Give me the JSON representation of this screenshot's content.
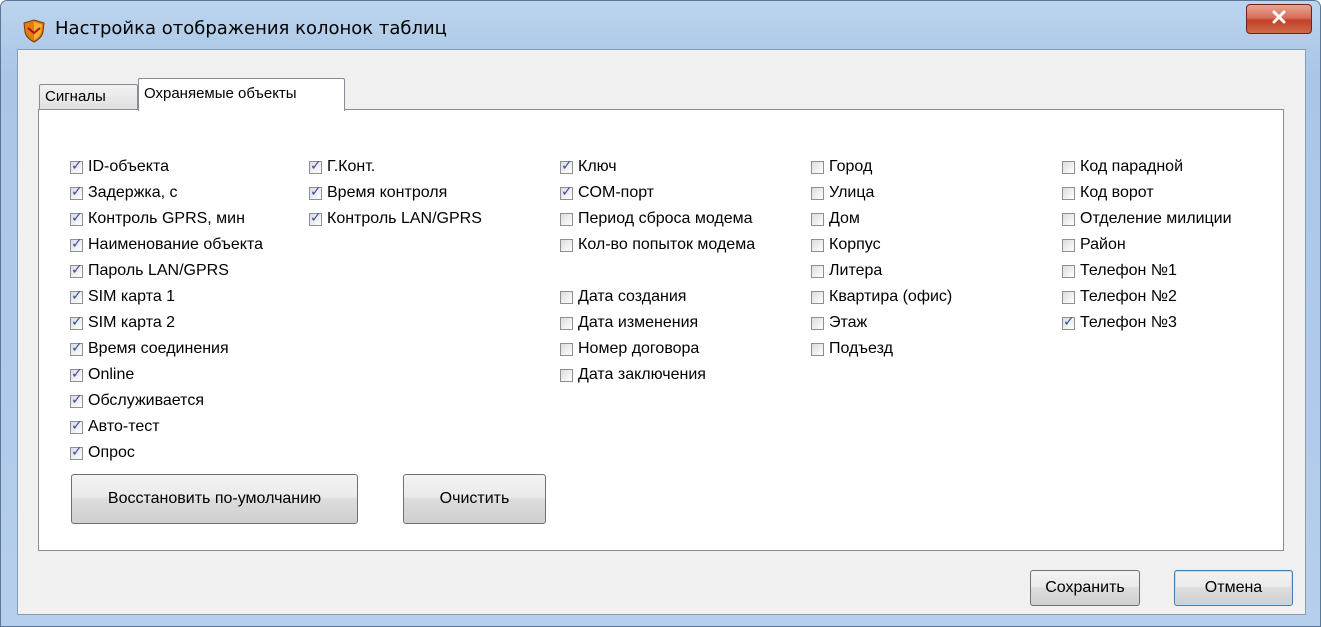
{
  "window": {
    "title": "Настройка отображения колонок таблиц",
    "icon": "shield-icon",
    "close_icon": "close-icon"
  },
  "tabs": [
    {
      "label": "Сигналы",
      "active": false
    },
    {
      "label": "Охраняемые объекты",
      "active": true
    }
  ],
  "columns": [
    {
      "items": [
        {
          "label": "ID-объекта",
          "checked": true
        },
        {
          "label": "Задержка, с",
          "checked": true
        },
        {
          "label": "Контроль GPRS, мин",
          "checked": true
        },
        {
          "label": "Наименование объекта",
          "checked": true
        },
        {
          "label": "Пароль LAN/GPRS",
          "checked": true
        },
        {
          "label": "SIM карта 1",
          "checked": true
        },
        {
          "label": "SIM карта 2",
          "checked": true
        },
        {
          "label": "Время соединения",
          "checked": true
        },
        {
          "label": "Online",
          "checked": true
        },
        {
          "label": "Обслуживается",
          "checked": true
        },
        {
          "label": "Авто-тест",
          "checked": true
        },
        {
          "label": "Опрос",
          "checked": true
        }
      ]
    },
    {
      "items": [
        {
          "label": "Г.Конт.",
          "checked": true
        },
        {
          "label": "Время контроля",
          "checked": true
        },
        {
          "label": "Контроль LAN/GPRS",
          "checked": true
        }
      ]
    },
    {
      "items": [
        {
          "label": "Ключ",
          "checked": true
        },
        {
          "label": "COM-порт",
          "checked": true
        },
        {
          "label": "Период сброса модема",
          "checked": false
        },
        {
          "label": "Кол-во попыток модема",
          "checked": false
        },
        {
          "gap": true
        },
        {
          "label": "Дата создания",
          "checked": false
        },
        {
          "label": "Дата изменения",
          "checked": false
        },
        {
          "label": "Номер договора",
          "checked": false
        },
        {
          "label": "Дата заключения",
          "checked": false
        }
      ]
    },
    {
      "items": [
        {
          "label": "Город",
          "checked": false
        },
        {
          "label": "Улица",
          "checked": false
        },
        {
          "label": "Дом",
          "checked": false
        },
        {
          "label": "Корпус",
          "checked": false
        },
        {
          "label": "Литера",
          "checked": false
        },
        {
          "label": "Квартира (офис)",
          "checked": false
        },
        {
          "label": "Этаж",
          "checked": false
        },
        {
          "label": "Подъезд",
          "checked": false
        }
      ]
    },
    {
      "items": [
        {
          "label": "Код парадной",
          "checked": false
        },
        {
          "label": "Код ворот",
          "checked": false
        },
        {
          "label": "Отделение милиции",
          "checked": false
        },
        {
          "label": "Район",
          "checked": false
        },
        {
          "label": "Телефон №1",
          "checked": false
        },
        {
          "label": "Телефон №2",
          "checked": false
        },
        {
          "label": "Телефон №3",
          "checked": true
        }
      ]
    }
  ],
  "panel_buttons": {
    "restore_defaults": "Восстановить по-умолчанию",
    "clear": "Очистить"
  },
  "dialog_buttons": {
    "save": "Сохранить",
    "cancel": "Отмена"
  },
  "colors": {
    "checkmark": "#3b4fa8",
    "close_button": "#c24128",
    "titlebar": "#b5cfec"
  }
}
